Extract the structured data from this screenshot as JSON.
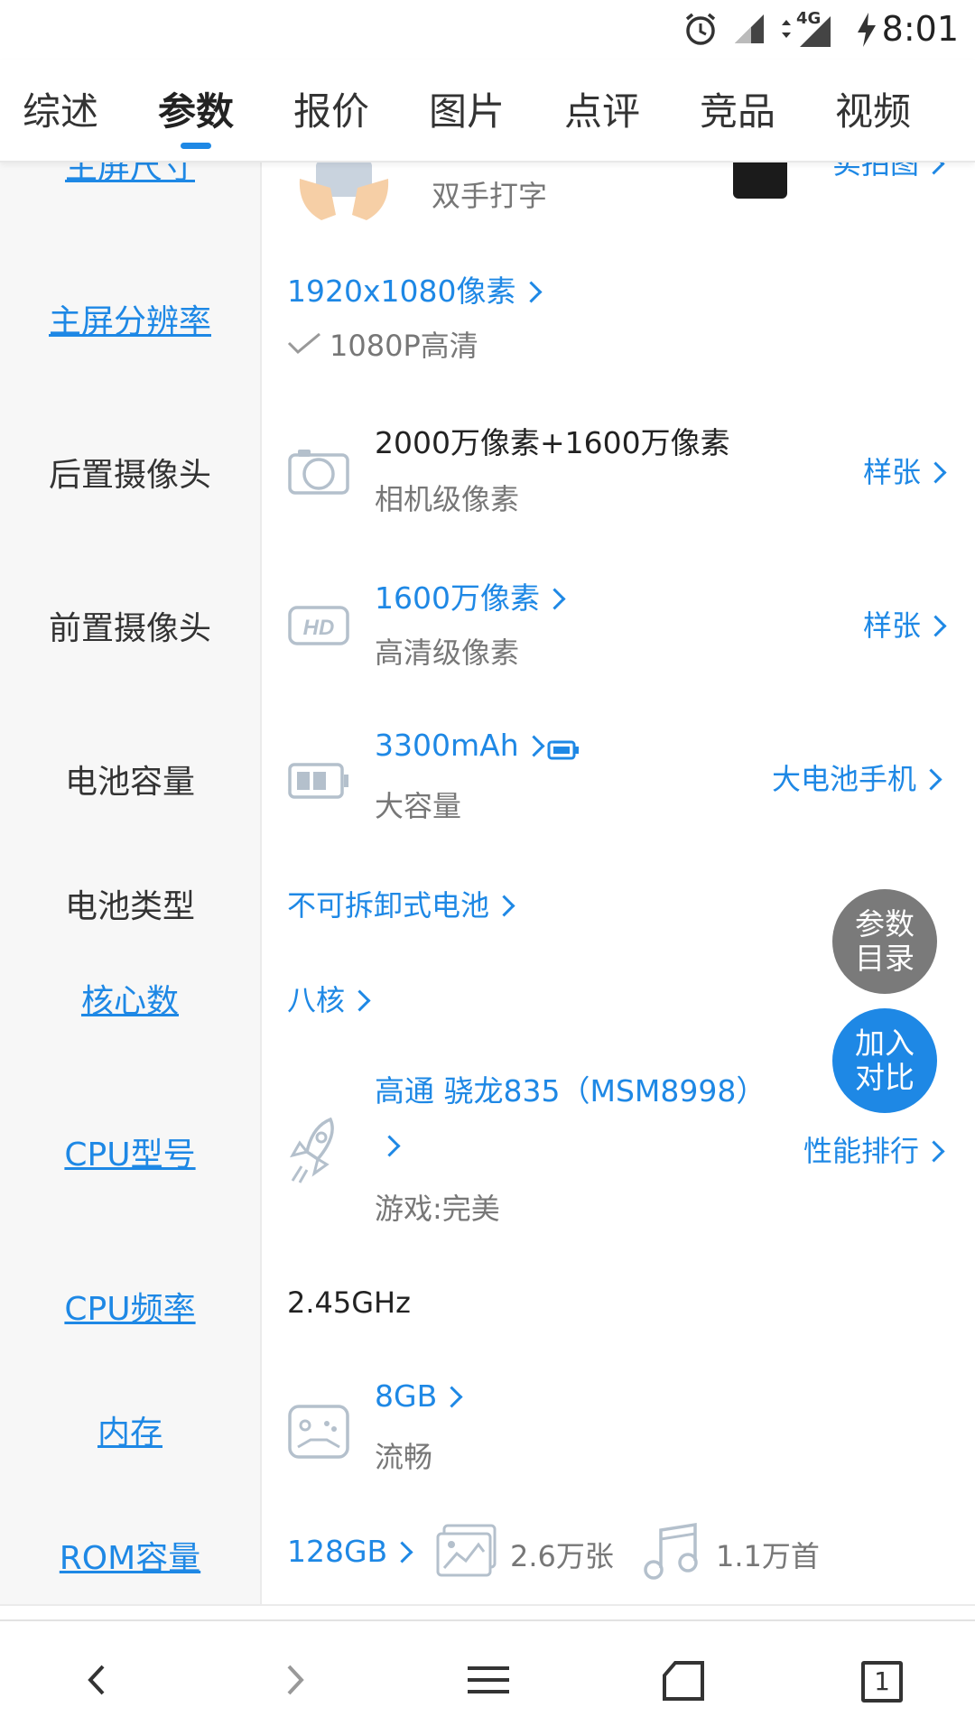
{
  "status": {
    "time": "8:01",
    "network": "4G"
  },
  "tabs": [
    {
      "label": "综述"
    },
    {
      "label": "参数"
    },
    {
      "label": "报价"
    },
    {
      "label": "图片"
    },
    {
      "label": "点评"
    },
    {
      "label": "竞品"
    },
    {
      "label": "视频"
    }
  ],
  "partial_row": {
    "label": "主屏尺寸",
    "sub": "双手打字",
    "link": "实拍图"
  },
  "rows": {
    "resolution": {
      "label": "主屏分辨率",
      "value": "1920x1080像素",
      "sub": "1080P高清"
    },
    "rear_camera": {
      "label": "后置摄像头",
      "value": "2000万像素+1600万像素",
      "sub": "相机级像素",
      "link": "样张"
    },
    "front_camera": {
      "label": "前置摄像头",
      "value": "1600万像素",
      "sub": "高清级像素",
      "link": "样张"
    },
    "battery": {
      "label": "电池容量",
      "value": "3300mAh",
      "sub": "大容量",
      "link": "大电池手机"
    },
    "battery_type": {
      "label": "电池类型",
      "value": "不可拆卸式电池"
    },
    "cores": {
      "label": "核心数",
      "value": "八核"
    },
    "cpu_model": {
      "label": "CPU型号",
      "value": "高通 骁龙835（MSM8998）",
      "sub": "游戏:完美",
      "link": "性能排行"
    },
    "cpu_freq": {
      "label": "CPU频率",
      "value": "2.45GHz"
    },
    "memory": {
      "label": "内存",
      "value": "8GB",
      "sub": "流畅"
    },
    "rom": {
      "label": "ROM容量",
      "value": "128GB",
      "photos": "2.6万张",
      "songs": "1.1万首"
    }
  },
  "floating": {
    "catalog_line1": "参数",
    "catalog_line2": "目录",
    "compare_line1": "加入",
    "compare_line2": "对比"
  },
  "bottom_nav": {
    "tab_count": "1"
  },
  "colors": {
    "accent": "#1e88e5",
    "catalog_bg": "#7a7a7a",
    "label_bg": "#f7f7f7"
  }
}
